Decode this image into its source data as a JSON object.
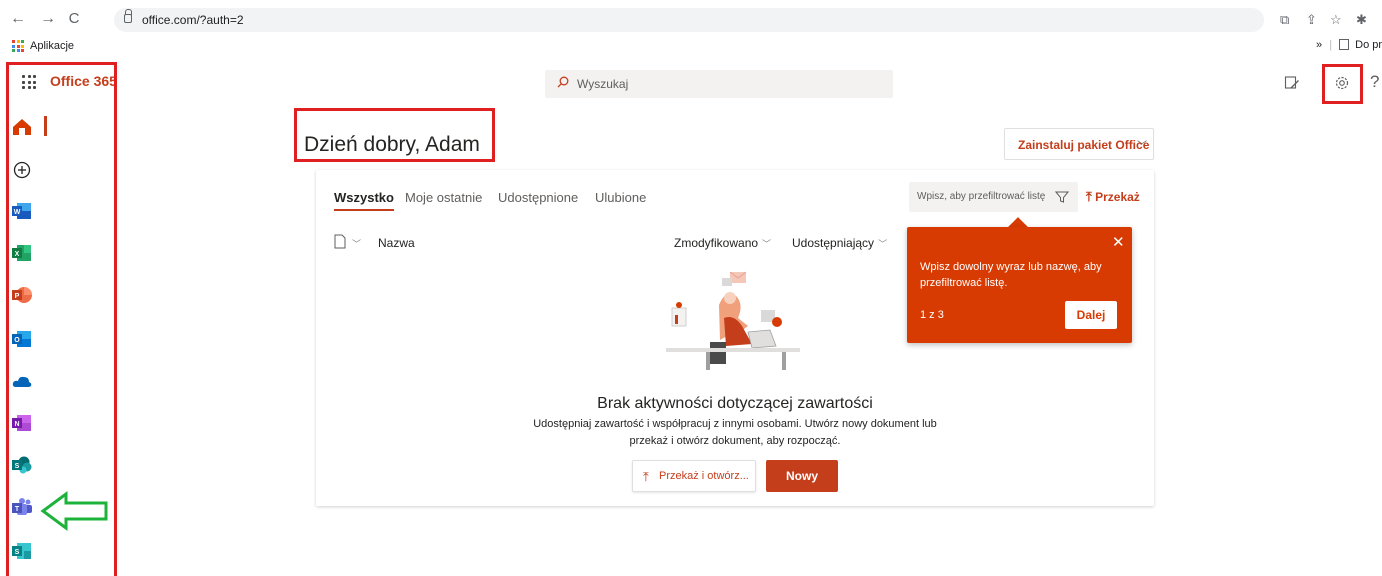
{
  "browser": {
    "url": "office.com/?auth=2",
    "bookmarks": {
      "apps_label": "Aplikacje",
      "overflow": "»",
      "right_item": "Do prz"
    }
  },
  "header": {
    "brand": "Office 365",
    "search_placeholder": "Wyszukaj"
  },
  "apps": [
    {
      "name": "Home",
      "icon": "home-icon"
    },
    {
      "name": "Create",
      "icon": "plus-circle-icon"
    },
    {
      "name": "Word",
      "icon": "word-icon"
    },
    {
      "name": "Excel",
      "icon": "excel-icon"
    },
    {
      "name": "PowerPoint",
      "icon": "powerpoint-icon"
    },
    {
      "name": "Outlook",
      "icon": "outlook-icon"
    },
    {
      "name": "OneDrive",
      "icon": "onedrive-icon"
    },
    {
      "name": "OneNote",
      "icon": "onenote-icon"
    },
    {
      "name": "SharePoint",
      "icon": "sharepoint-icon"
    },
    {
      "name": "Teams",
      "icon": "teams-icon"
    },
    {
      "name": "Sway",
      "icon": "sway-icon"
    }
  ],
  "main": {
    "greeting": "Dzień dobry, Adam",
    "install_label": "Zainstaluj pakiet Office",
    "tabs": [
      {
        "label": "Wszystko",
        "active": true
      },
      {
        "label": "Moje ostatnie",
        "active": false
      },
      {
        "label": "Udostępnione",
        "active": false
      },
      {
        "label": "Ulubione",
        "active": false
      }
    ],
    "filter_placeholder": "Wpisz, aby przefiltrować listę",
    "upload_label": "Przekaż",
    "columns": {
      "name": "Nazwa",
      "modified": "Zmodyfikowano",
      "shared_by": "Udostępniający"
    },
    "empty_state": {
      "title": "Brak aktywności dotyczącej zawartości",
      "description_line1": "Udostępniaj zawartość i współpracuj z innymi osobami. Utwórz nowy dokument lub",
      "description_line2": "przekaż i otwórz dokument, aby rozpocząć.",
      "upload_open_label": "Przekaż i otwórz...",
      "new_label": "Nowy"
    }
  },
  "coachmark": {
    "message": "Wpisz dowolny wyraz lub nazwę, aby przefiltrować listę.",
    "counter": "1 z 3",
    "next_label": "Dalej"
  },
  "colors": {
    "accent": "#c43e1c",
    "coach_bg": "#d83b01",
    "annotation_red": "#e02020",
    "annotation_green": "#1db33a"
  }
}
